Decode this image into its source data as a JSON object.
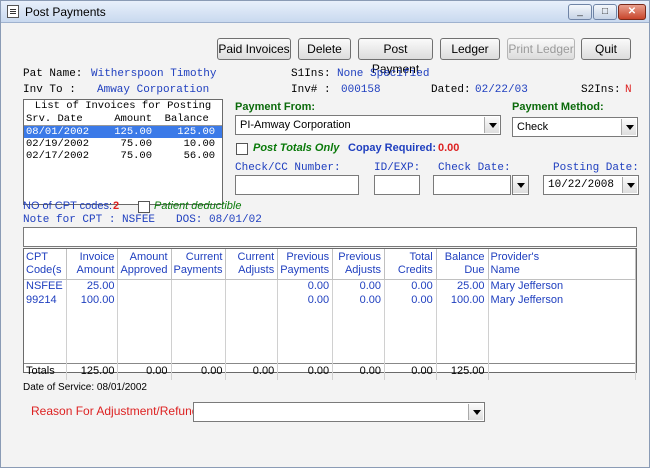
{
  "window": {
    "title": "Post Payments"
  },
  "toolbar": {
    "paid_invoices": "Paid Invoices",
    "delete": "Delete",
    "post_payment": "Post Payment",
    "ledger": "Ledger",
    "print_ledger": "Print Ledger",
    "quit": "Quit"
  },
  "patient": {
    "name_label": "Pat Name:",
    "name_value": "Witherspoon Timothy",
    "s1ins_label": "S1Ins:",
    "s1ins_value": "None Specified",
    "invto_label": "Inv To  :",
    "invto_value": "Amway Corporation",
    "inv_label": "Inv#  :",
    "inv_value": "000158",
    "dated_label": "Dated:",
    "dated_value": "02/22/03",
    "s2ins_label": "S2Ins:",
    "s2ins_value": "N"
  },
  "invoice_list": {
    "title": "List of Invoices for Posting",
    "headers": [
      "Srv. Date",
      "Amount",
      "Balance"
    ],
    "rows": [
      {
        "date": "08/01/2002",
        "amount": "125.00",
        "balance": "125.00",
        "selected": true
      },
      {
        "date": "02/19/2002",
        "amount": "75.00",
        "balance": "10.00",
        "selected": false
      },
      {
        "date": "02/17/2002",
        "amount": "75.00",
        "balance": "56.00",
        "selected": false
      }
    ]
  },
  "payment": {
    "from_label": "Payment From:",
    "from_value": "PI-Amway Corporation",
    "method_label": "Payment Method:",
    "method_value": "Check",
    "post_totals_label": "Post Totals Only",
    "copay_label": "Copay Required:",
    "copay_value": "0.00",
    "check_cc_label": "Check/CC Number:",
    "id_exp_label": "ID/EXP:",
    "check_date_label": "Check Date:",
    "posting_date_label": "Posting Date:",
    "posting_date_value": "10/22/2008"
  },
  "cpt": {
    "count_label": "NO of CPT codes:",
    "count_value": "2",
    "patient_deductible_label": "Patient deductible",
    "note_label": "Note for CPT : NSFEE",
    "dos_label": "DOS: 08/01/02"
  },
  "grid": {
    "headers": [
      [
        "CPT",
        "Code(s"
      ],
      [
        "Invoice",
        "Amount"
      ],
      [
        "Amount",
        "Approved"
      ],
      [
        "Current",
        "Payments"
      ],
      [
        "Current",
        "Adjusts"
      ],
      [
        "Previous",
        "Payments"
      ],
      [
        "Previous",
        "Adjusts"
      ],
      [
        "Total",
        "Credits"
      ],
      [
        "Balance",
        "Due"
      ],
      [
        "Provider's",
        "Name"
      ]
    ],
    "rows": [
      [
        "NSFEE",
        "25.00",
        "",
        "",
        "",
        "0.00",
        "0.00",
        "0.00",
        "25.00",
        "Mary Jefferson"
      ],
      [
        "99214",
        "100.00",
        "",
        "",
        "",
        "0.00",
        "0.00",
        "0.00",
        "100.00",
        "Mary Jefferson"
      ]
    ],
    "totals": [
      "Totals",
      "125.00",
      "0.00",
      "0.00",
      "0.00",
      "0.00",
      "0.00",
      "0.00",
      "125.00",
      ""
    ]
  },
  "footer": {
    "date_of_service": "Date of Service: 08/01/2002",
    "reason_label": "Reason For Adjustment/Refund:",
    "reason_value": ""
  }
}
